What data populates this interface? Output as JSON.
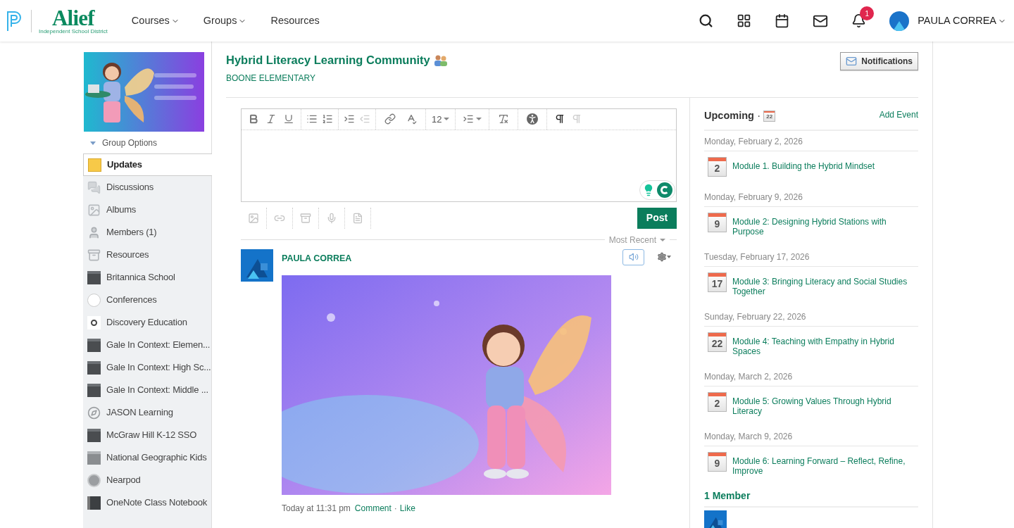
{
  "header": {
    "logo_name": "Alief",
    "logo_tagline": "Independent School District",
    "nav": [
      {
        "label": "Courses",
        "dropdown": true
      },
      {
        "label": "Groups",
        "dropdown": true
      },
      {
        "label": "Resources",
        "dropdown": false
      }
    ],
    "notification_count": "1",
    "user": "PAULA CORREA"
  },
  "sidebar": {
    "group_options": "Group Options",
    "items": [
      {
        "label": "Updates",
        "kind": "updates",
        "selected": true
      },
      {
        "label": "Discussions",
        "kind": "discussions",
        "selected": false
      },
      {
        "label": "Albums",
        "kind": "albums",
        "selected": false
      },
      {
        "label": "Members (1)",
        "kind": "members",
        "selected": false
      },
      {
        "label": "Resources",
        "kind": "resources",
        "selected": false
      },
      {
        "label": "Britannica School",
        "kind": "app_dark",
        "selected": false
      },
      {
        "label": "Conferences",
        "kind": "conference",
        "selected": false
      },
      {
        "label": "Discovery Education",
        "kind": "discovery",
        "selected": false
      },
      {
        "label": "Gale In Context: Elemen...",
        "kind": "app_dark",
        "selected": false
      },
      {
        "label": "Gale In Context: High Sc...",
        "kind": "app_dark",
        "selected": false
      },
      {
        "label": "Gale In Context: Middle ...",
        "kind": "app_dark",
        "selected": false
      },
      {
        "label": "JASON Learning",
        "kind": "compass",
        "selected": false
      },
      {
        "label": "McGraw Hill K-12 SSO",
        "kind": "app_dark",
        "selected": false
      },
      {
        "label": "National Geographic Kids",
        "kind": "app_gray",
        "selected": false
      },
      {
        "label": "Nearpod",
        "kind": "nearpod",
        "selected": false
      },
      {
        "label": "OneNote Class Notebook",
        "kind": "onenote",
        "selected": false
      }
    ]
  },
  "page": {
    "title": "Hybrid Literacy Learning Community",
    "subtitle": "BOONE ELEMENTARY",
    "notifications_button": "Notifications"
  },
  "editor": {
    "font_size": "12",
    "post_button": "Post"
  },
  "feed": {
    "sort": "Most Recent",
    "posts": [
      {
        "author": "PAULA CORREA",
        "time": "Today at 11:31 pm",
        "separator": "·",
        "actions": [
          "Comment",
          "Like"
        ]
      }
    ]
  },
  "upcoming": {
    "title": "Upcoming",
    "separator": "·",
    "calendar_day": "22",
    "add_event": "Add Event",
    "events": [
      {
        "date": "Monday, February 2, 2026",
        "day": "2",
        "title": "Module 1. Building the Hybrid Mindset"
      },
      {
        "date": "Monday, February 9, 2026",
        "day": "9",
        "title": "Module 2: Designing Hybrid Stations with Purpose"
      },
      {
        "date": "Tuesday, February 17, 2026",
        "day": "17",
        "title": "Module 3: Bringing Literacy and Social Studies Together"
      },
      {
        "date": "Sunday, February 22, 2026",
        "day": "22",
        "title": "Module 4: Teaching with Empathy in Hybrid Spaces"
      },
      {
        "date": "Monday, March 2, 2026",
        "day": "2",
        "title": "Module 5: Growing Values Through Hybrid Literacy"
      },
      {
        "date": "Monday, March 9, 2026",
        "day": "9",
        "title": "Module 6: Learning Forward – Reflect, Refine, Improve"
      }
    ]
  },
  "members": {
    "title": "1 Member"
  }
}
